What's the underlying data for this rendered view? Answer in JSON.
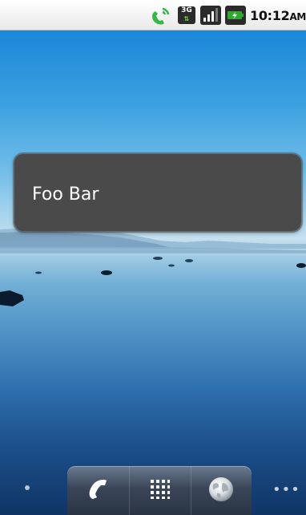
{
  "status_bar": {
    "network_type": "3G",
    "time": "10:12",
    "ampm": "AM",
    "icons": [
      "call-in-progress-icon",
      "3g-data-icon",
      "signal-strength-icon",
      "battery-charging-icon"
    ]
  },
  "toast": {
    "message": "Foo Bar"
  },
  "dock": {
    "items": [
      {
        "name": "phone",
        "icon": "phone-icon"
      },
      {
        "name": "launcher",
        "icon": "app-grid-icon"
      },
      {
        "name": "browser",
        "icon": "globe-icon"
      }
    ]
  },
  "colors": {
    "toast_bg": "#4a4a4a",
    "status_bar_bg": "#ffffff",
    "battery_green": "#2fa82f",
    "call_green": "#3bb54a"
  }
}
